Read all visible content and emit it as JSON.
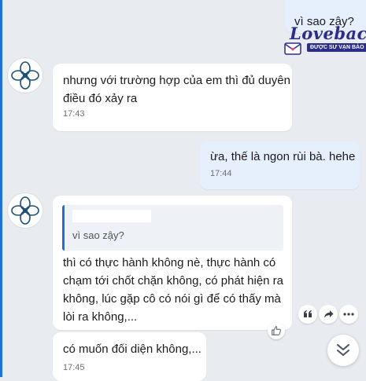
{
  "messages": [
    {
      "text": "vì sao zậy?"
    },
    {
      "text": "nhưng với trường hợp của em thì đủ duyên\nđiều đó xảy ra",
      "time": "17:43"
    },
    {
      "text": "ừa, thế là ngon rùi bà. hehe",
      "time": "17:44"
    },
    {
      "quote": "vì sao zậy?",
      "text": "thì có thực hành không nè, thực hành có\nchạm tới chốt chặn không, có phát hiện ra\nkhông, lúc gặp cô có nói gì để có thấy mà\nlòi ra không,..."
    },
    {
      "text": "có muốn đối diện không,...",
      "time": "17:45"
    }
  ],
  "sticker": {
    "main": "Loveback",
    "tag": "ĐƯỢC SƯ VẠN BẢO"
  },
  "icons": {
    "quote": "quote-icon",
    "forward": "forward-icon",
    "more": "more-icon",
    "react": "thumbs-up-icon",
    "scroll": "chevron-down-double-icon",
    "avatar": "flower-icon"
  },
  "colors": {
    "accent": "#1f6fd8",
    "incoming": "#ffffff",
    "outgoing": "#e6f0fd",
    "background": "#e8ebf0"
  }
}
